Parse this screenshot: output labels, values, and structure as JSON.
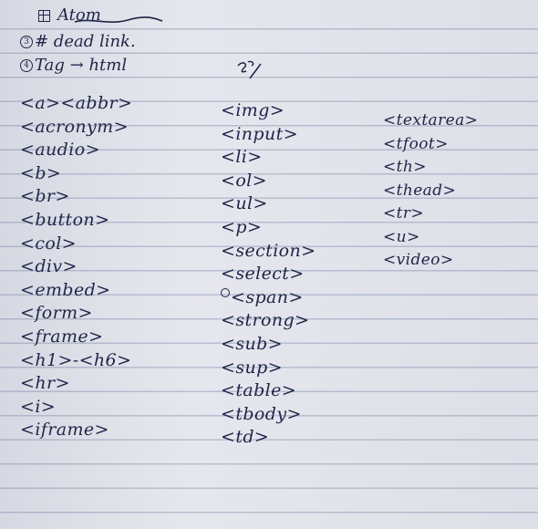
{
  "header": {
    "title": "Atom",
    "line_2": "# dead link.",
    "line_3_tag": "Tag",
    "line_3_arrow": "→",
    "line_3_target": "html"
  },
  "columns": [
    [
      "<a><abbr>",
      "<acronym>",
      "<audio>",
      "<b>",
      "<br>",
      "<button>",
      "<col>",
      "<div>",
      "<embed>",
      "<form>",
      "<frame>",
      "<h1>-<h6>",
      "<hr>",
      "<i>",
      "<iframe>"
    ],
    [
      "<img>",
      "<input>",
      "<li>",
      "<ol>",
      "<ul>",
      "<p>",
      "<section>",
      "<select>",
      "<span>",
      "<strong>",
      "<sub>",
      "<sup>",
      "<table>",
      "<tbody>",
      "<td>"
    ],
    [
      "<textarea>",
      "<tfoot>",
      "<th>",
      "<thead>",
      "<tr>",
      "<u>",
      "<video>"
    ]
  ],
  "colors": {
    "ink": "#1d2347",
    "paper": "#e6e7ee",
    "rule_line": "#b8bfd0"
  }
}
